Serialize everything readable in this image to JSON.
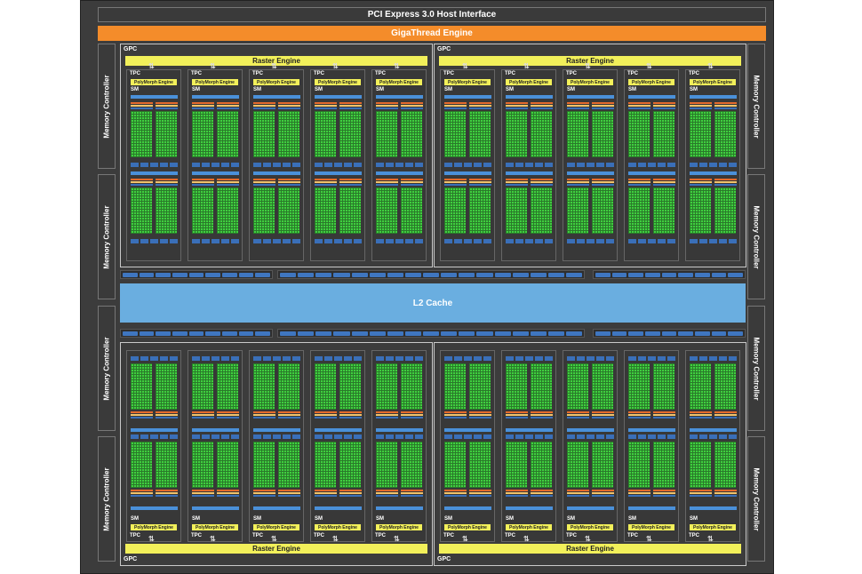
{
  "header": {
    "pcie_label": "PCI Express 3.0 Host Interface",
    "gigathread_label": "GigaThread Engine"
  },
  "memory_controller_label": "Memory Controller",
  "l2_label": "L2 Cache",
  "gpc": {
    "label": "GPC",
    "raster_label": "Raster Engine",
    "tpc_label": "TPC",
    "polymorph_label": "PolyMorph Engine",
    "sm_label": "SM",
    "tpc_per_gpc": 5,
    "count": 4
  },
  "colors": {
    "chip_bg": "#3c3c3c",
    "gigathread": "#f48c2a",
    "raster": "#f2f05a",
    "l2": "#6aaee0",
    "core": "#3fcf3f",
    "dispatch": "#4a90d9"
  }
}
